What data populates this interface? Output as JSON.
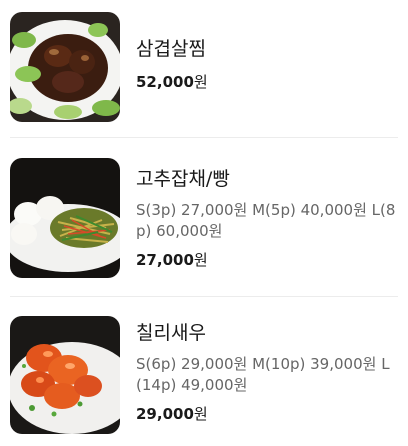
{
  "menu": {
    "items": [
      {
        "name": "삼겹살찜",
        "options": "",
        "price_num": "52,000",
        "price_unit": "원",
        "image_icon": "braised-pork-dish"
      },
      {
        "name": "고추잡채/빵",
        "options": "S(3p) 27,000원 M(5p) 40,000원 L(8p) 60,000원",
        "price_num": "27,000",
        "price_unit": "원",
        "image_icon": "japchae-with-buns-dish"
      },
      {
        "name": "칠리새우",
        "options": "S(6p) 29,000원 M(10p) 39,000원 L(14p) 49,000원",
        "price_num": "29,000",
        "price_unit": "원",
        "image_icon": "chili-shrimp-dish"
      }
    ]
  },
  "colors": {
    "divider": "#ececec",
    "text_primary": "#1a1a1a",
    "text_secondary": "#666666"
  }
}
